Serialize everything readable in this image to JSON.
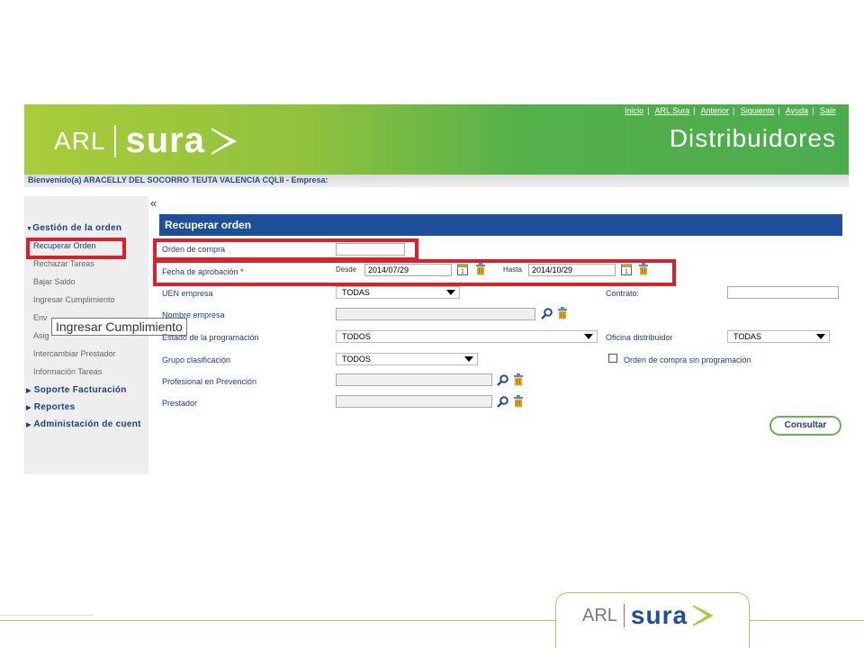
{
  "header": {
    "brand_arl": "ARL",
    "brand_sura": "sura",
    "section_title": "Distribuidores",
    "links": [
      "Inicio",
      "ARL Sura",
      "Anterior",
      "Siguiente",
      "Ayuda",
      "Salir"
    ],
    "welcome": "Bienvenido(a) ARACELLY DEL SOCORRO TEUTA VALENCIA CQLII - Empresa:"
  },
  "sidebar": {
    "collapse": "«",
    "group1": "Gestión de la orden",
    "items": [
      "Recuperar Orden",
      "Rechazar Tareas",
      "Bajar Saldo",
      "Ingresar Cumplimiento",
      "Env",
      "Asig",
      "Intercambiar Prestador",
      "Información Tareas"
    ],
    "group2": "Soporte Facturación",
    "group3": "Reportes",
    "group4": "Administación de cuent",
    "tooltip": "Ingresar Cumplimiento"
  },
  "form": {
    "title": "Recuperar orden",
    "orden_label": "Orden de compra",
    "orden_value": "",
    "fecha_label": "Fecha de aprobación",
    "required_mark": "*",
    "desde_label": "Desde",
    "desde_value": "2014/07/29",
    "hasta_label": "Hasta",
    "hasta_value": "2014/10/29",
    "uen_label": "UEN empresa",
    "uen_value": "TODAS",
    "contrato_label": "Contrato:",
    "contrato_value": "",
    "nombre_label": "Nombre empresa",
    "nombre_value": "",
    "estado_label": "Estado de la programación",
    "estado_value": "TODOS",
    "oficina_label": "Oficina distribuidor",
    "oficina_value": "TODAS",
    "grupo_label": "Grupo clasificación",
    "grupo_value": "TODOS",
    "sin_prog_label": "Orden de compra sin programación",
    "profesional_label": "Profesional en Prevención",
    "profesional_value": "",
    "prestador_label": "Prestador",
    "prestador_value": "",
    "consultar": "Consultar"
  },
  "footer": {
    "brand_arl": "ARL",
    "brand_sura": "sura"
  },
  "colors": {
    "accent_blue": "#1d4f9a",
    "header_green": "#4aad4c",
    "highlight_red": "#d9202c"
  },
  "icons": [
    "search-icon",
    "trash-icon",
    "calendar-icon",
    "chevron-down-icon",
    "caret-right-icon",
    "caret-down-icon"
  ]
}
